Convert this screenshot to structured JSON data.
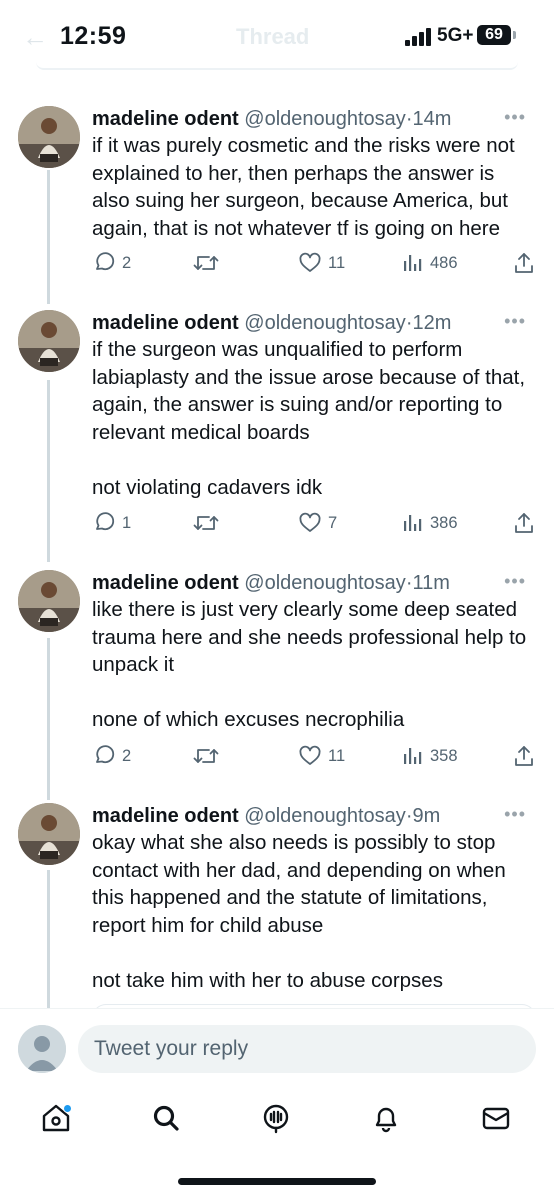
{
  "status_bar": {
    "time": "12:59",
    "network": "5G+",
    "battery": "69",
    "page_title": "Thread"
  },
  "tweets": [
    {
      "name": "madeline odent",
      "handle": "@oldenoughtosay",
      "time": "14m",
      "text": "if it was purely cosmetic and the risks were not explained to her, then perhaps the answer is also suing her surgeon, because America, but again, that is not whatever tf is going on here",
      "replies": "2",
      "retweets": "",
      "likes": "11",
      "views": "486"
    },
    {
      "name": "madeline odent",
      "handle": "@oldenoughtosay",
      "time": "12m",
      "text": "if the surgeon was unqualified to perform labiaplasty and the issue arose because of that, again, the answer is suing and/or reporting to relevant medical boards\n\nnot violating cadavers idk",
      "replies": "1",
      "retweets": "",
      "likes": "7",
      "views": "386"
    },
    {
      "name": "madeline odent",
      "handle": "@oldenoughtosay",
      "time": "11m",
      "text": "like there is just very clearly some deep seated trauma here and she needs professional help to unpack it\n\nnone of which excuses necrophilia",
      "replies": "2",
      "retweets": "",
      "likes": "11",
      "views": "358"
    },
    {
      "name": "madeline odent",
      "handle": "@oldenoughtosay",
      "time": "9m",
      "text": "okay what she also needs is possibly to stop contact with her dad, and depending on when this happened and the statute of limitations, report him for child abuse\n\nnot take him with her to abuse corpses"
    }
  ],
  "reply": {
    "placeholder": "Tweet your reply"
  },
  "icons": {
    "reply": "reply-icon",
    "retweet": "retweet-icon",
    "like": "heart-icon",
    "views": "views-icon",
    "share": "share-icon",
    "more": "more-icon",
    "home": "home-icon",
    "search": "search-icon",
    "spaces": "spaces-icon",
    "notifications": "bell-icon",
    "messages": "mail-icon"
  },
  "colors": {
    "accent": "#1d9bf0",
    "text": "#0f1419",
    "secondary": "#536471",
    "thread_line": "#cfd9de"
  }
}
